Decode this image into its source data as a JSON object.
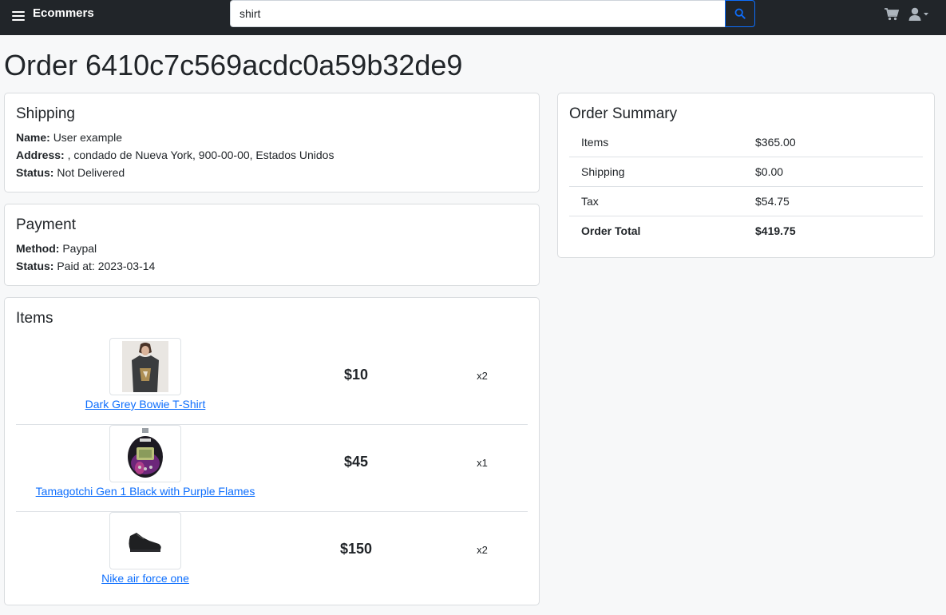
{
  "navbar": {
    "brand": "Ecommers",
    "search_value": "shirt",
    "icons": [
      "menu-icon",
      "search-icon",
      "cart-icon",
      "user-icon"
    ]
  },
  "page": {
    "title": "Order 6410c7c569acdc0a59b32de9"
  },
  "shipping": {
    "heading": "Shipping",
    "name_label": "Name:",
    "name_value": "User example",
    "address_label": "Address:",
    "address_value": ", condado de Nueva York, 900-00-00, Estados Unidos",
    "status_label": "Status:",
    "status_value": "Not Delivered"
  },
  "payment": {
    "heading": "Payment",
    "method_label": "Method:",
    "method_value": "Paypal",
    "status_label": "Status:",
    "status_value": "Paid at: 2023-03-14"
  },
  "items": {
    "heading": "Items",
    "list": [
      {
        "name": "Dark Grey Bowie T-Shirt",
        "price": "$10",
        "qty": "x2",
        "image_icon": "tshirt-photo"
      },
      {
        "name": "Tamagotchi Gen 1 Black with Purple Flames",
        "price": "$45",
        "qty": "x1",
        "image_icon": "tamagotchi-photo"
      },
      {
        "name": "Nike air force one",
        "price": "$150",
        "qty": "x2",
        "image_icon": "sneaker-photo"
      }
    ]
  },
  "summary": {
    "heading": "Order Summary",
    "rows": [
      {
        "label": "Items",
        "value": "$365.00"
      },
      {
        "label": "Shipping",
        "value": "$0.00"
      },
      {
        "label": "Tax",
        "value": "$54.75"
      },
      {
        "label": "Order Total",
        "value": "$419.75"
      }
    ]
  },
  "colors": {
    "navbar_bg": "#212529",
    "link": "#0d6efd",
    "page_bg": "#f7f8f9"
  }
}
